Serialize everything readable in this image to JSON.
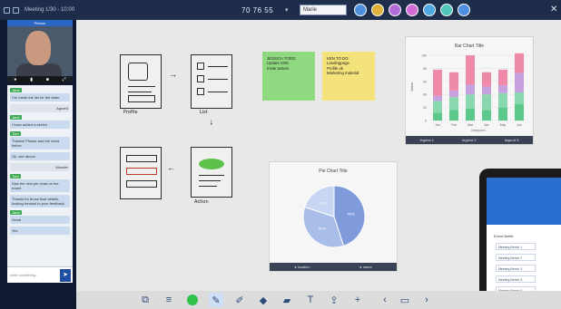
{
  "topbar": {
    "title": "Meeting 1/30 - 10:00",
    "timer": "70 76 55",
    "dropdown_value": "Marie",
    "avatar_colors": [
      "#4f8fe0",
      "#e0b23a",
      "#b06cd8",
      "#d36cd8",
      "#4fa8e0",
      "#4fc6b8",
      "#4f8fe0"
    ]
  },
  "video": {
    "header": "Person"
  },
  "chat": {
    "messages": [
      {
        "name": "Jane",
        "side": "left",
        "text": "I've made the list for the team"
      },
      {
        "name": "",
        "side": "right",
        "text": "Agreed"
      },
      {
        "name": "Jane",
        "side": "left",
        "text": "I have added a sketch"
      },
      {
        "name": "Tom",
        "side": "left",
        "text": "Thanks! Please add the chart below"
      },
      {
        "name": "",
        "side": "left",
        "text": "Ok, see above"
      },
      {
        "name": "",
        "side": "right",
        "text": "Wonder"
      },
      {
        "name": "Tom",
        "side": "left",
        "text": "Saw the new pie chart on the board"
      },
      {
        "name": "",
        "side": "left",
        "text": "Thanks for those final details, looking forward to your feedback"
      },
      {
        "name": "Jane",
        "side": "left",
        "text": "Great"
      },
      {
        "name": "",
        "side": "left",
        "text": "Yes"
      }
    ],
    "input_placeholder": "write something..."
  },
  "sketches": {
    "profile_label": "Profile",
    "list_label": "List",
    "action_label": "Action"
  },
  "stickies": [
    {
      "color": "green",
      "lines": [
        "JESSICA TODO:",
        "Update SOE",
        "Invite testers"
      ]
    },
    {
      "color": "yellow",
      "lines": [
        "KEN TO DO:",
        "Landingpage",
        "Profile ok",
        "Marketing material"
      ]
    }
  ],
  "bar_chart": {
    "title": "Bar Chart Title",
    "legend": [
      "legend 1",
      "legend 2",
      "legend 3"
    ],
    "xlabel": "categories",
    "ylabel": "Value"
  },
  "pie_chart": {
    "title": "Pie Chart Title",
    "legend": [
      "● location",
      "● name"
    ]
  },
  "tablet": {
    "title": "Event Bottle",
    "items": [
      "Meeting Bench 1",
      "Meeting Bench 2",
      "Meeting Bench 3",
      "Meeting Bench 4",
      "Meeting Bench 5"
    ]
  },
  "toolbar": {
    "tools": [
      "layers-icon",
      "menu-icon",
      "color-dot",
      "pen-icon",
      "marker-icon",
      "eraser-icon",
      "sticky-note-icon",
      "text-icon",
      "upload-icon",
      "add-icon",
      "prev-page-icon",
      "page-icon",
      "next-page-icon"
    ],
    "active_color": "#2ec24a"
  },
  "chart_data": [
    {
      "type": "bar",
      "title": "Bar Chart Title",
      "categories": [
        "Jan",
        "Feb",
        "Mar",
        "Apr",
        "May",
        "Jun"
      ],
      "series": [
        {
          "name": "",
          "values": [
            12,
            16,
            18,
            16,
            20,
            25
          ]
        },
        {
          "name": "",
          "values": [
            18,
            20,
            22,
            24,
            22,
            18
          ]
        },
        {
          "name": "",
          "values": [
            8,
            10,
            15,
            12,
            12,
            30
          ]
        },
        {
          "name": "",
          "values": [
            40,
            28,
            45,
            22,
            24,
            30
          ]
        }
      ],
      "ylim": [
        0,
        100
      ],
      "ylabel": "Value"
    },
    {
      "type": "pie",
      "title": "Pie Chart Title",
      "labels": [
        "45%",
        "35%",
        "20%"
      ],
      "values": [
        45,
        35,
        20
      ]
    }
  ]
}
